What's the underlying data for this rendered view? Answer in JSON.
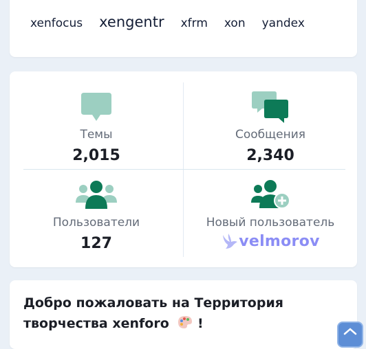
{
  "tags": [
    "xenfocus",
    "xengentr",
    "xfrm",
    "xon",
    "yandex"
  ],
  "stats": {
    "threads": {
      "label": "Темы",
      "value": "2,015"
    },
    "messages": {
      "label": "Сообщения",
      "value": "2,340"
    },
    "members": {
      "label": "Пользователи",
      "value": "127"
    },
    "newest": {
      "label": "Новый пользователь",
      "name": "velmorov"
    }
  },
  "welcome": {
    "title": "Добро пожаловать на Территория творчества xenforo",
    "suffix": "!"
  },
  "colors": {
    "icon_light": "#9ccfc1",
    "icon_dark": "#0d7a57",
    "brand": "#8b8df5"
  }
}
